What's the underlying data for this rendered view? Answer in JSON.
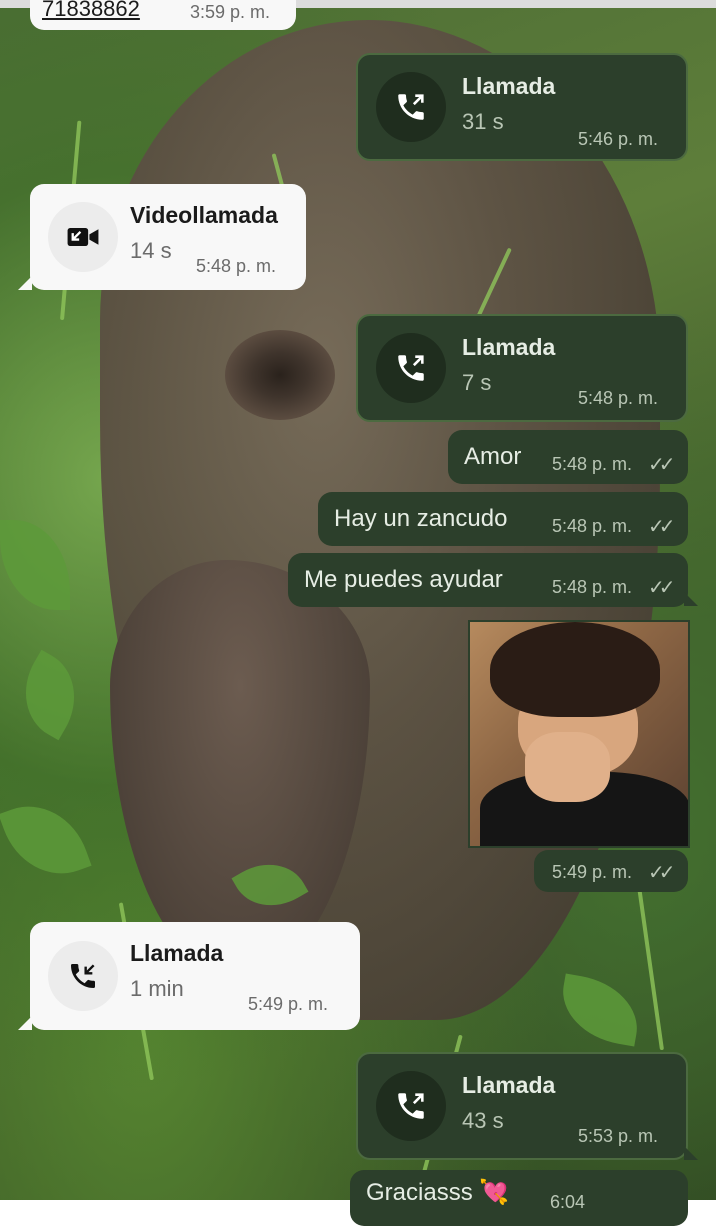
{
  "messages": {
    "top_partial": {
      "text": "71838862",
      "time": "3:59 p. m."
    },
    "call_out_1": {
      "title": "Llamada",
      "duration": "31 s",
      "time": "5:46 p. m.",
      "icon": "outgoing-call-icon"
    },
    "video_in_1": {
      "title": "Videollamada",
      "duration": "14 s",
      "time": "5:48 p. m.",
      "icon": "missed-video-call-icon"
    },
    "call_out_2": {
      "title": "Llamada",
      "duration": "7 s",
      "time": "5:48 p. m.",
      "icon": "outgoing-call-icon"
    },
    "text_1": {
      "text": "Amor",
      "time": "5:48 p. m."
    },
    "text_2": {
      "text": "Hay un zancudo",
      "time": "5:48 p. m."
    },
    "text_3": {
      "text": "Me puedes ayudar",
      "time": "5:48 p. m."
    },
    "photo_msg": {
      "time": "5:49 p. m.",
      "image": "crying-boy-photo"
    },
    "call_in_1": {
      "title": "Llamada",
      "duration": "1 min",
      "time": "5:49 p. m.",
      "icon": "incoming-call-icon"
    },
    "call_out_3": {
      "title": "Llamada",
      "duration": "43 s",
      "time": "5:53 p. m.",
      "icon": "outgoing-call-icon"
    },
    "bottom_partial": {
      "text": "Graciasss 💘",
      "time": "6:04"
    }
  },
  "status": {
    "read_ticks": "✓✓"
  },
  "colors": {
    "outgoing_bubble": "#2c3f2b",
    "incoming_bubble": "#f8f8f8"
  }
}
